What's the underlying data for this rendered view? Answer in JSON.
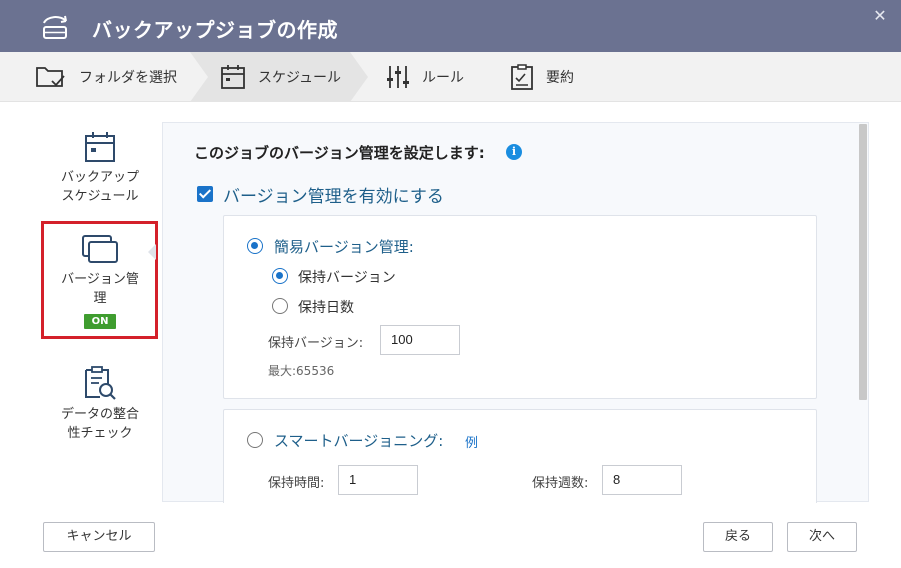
{
  "window": {
    "title": "バックアップジョブの作成",
    "close_glyph": "✕"
  },
  "steps": [
    {
      "label": "フォルダを選択",
      "icon": "folder-check-icon",
      "active": false
    },
    {
      "label": "スケジュール",
      "icon": "calendar-icon",
      "active": true
    },
    {
      "label": "ルール",
      "icon": "sliders-icon",
      "active": false
    },
    {
      "label": "要約",
      "icon": "clipboard-icon",
      "active": false
    }
  ],
  "sidebar": {
    "items": [
      {
        "label": "バックアップ\nスケジュール",
        "icon": "calendar-icon",
        "selected": false
      },
      {
        "label": "バージョン管\n理",
        "icon": "versions-icon",
        "selected": true,
        "badge": "ON"
      },
      {
        "label": "データの整合\n性チェック",
        "icon": "clipboard-search-icon",
        "selected": false
      }
    ],
    "selected_outline_color": "#d4202a",
    "badge_color": "#3f9d2f"
  },
  "main": {
    "heading": "このジョブのバージョン管理を設定します:",
    "info_glyph": "i",
    "enable_versioning": {
      "label": "バージョン管理を有効にする",
      "checked": true
    },
    "simple": {
      "label": "簡易バージョン管理:",
      "selected": true,
      "options": [
        {
          "label": "保持バージョン",
          "selected": true
        },
        {
          "label": "保持日数",
          "selected": false
        }
      ],
      "keep_versions_label": "保持バージョン:",
      "keep_versions_value": "100",
      "max_hint": "最大:65536"
    },
    "smart": {
      "label": "スマートバージョニング:",
      "selected": false,
      "example_link": "例",
      "hours_label": "保持時間:",
      "hours_value": "1",
      "weeks_label": "保持週数:",
      "weeks_value": "8"
    }
  },
  "footer": {
    "cancel": "キャンセル",
    "back": "戻る",
    "next": "次へ"
  },
  "colors": {
    "titlebar": "#6b7291",
    "accent": "#1a73c9",
    "stepbar": "#f2f2f2"
  }
}
